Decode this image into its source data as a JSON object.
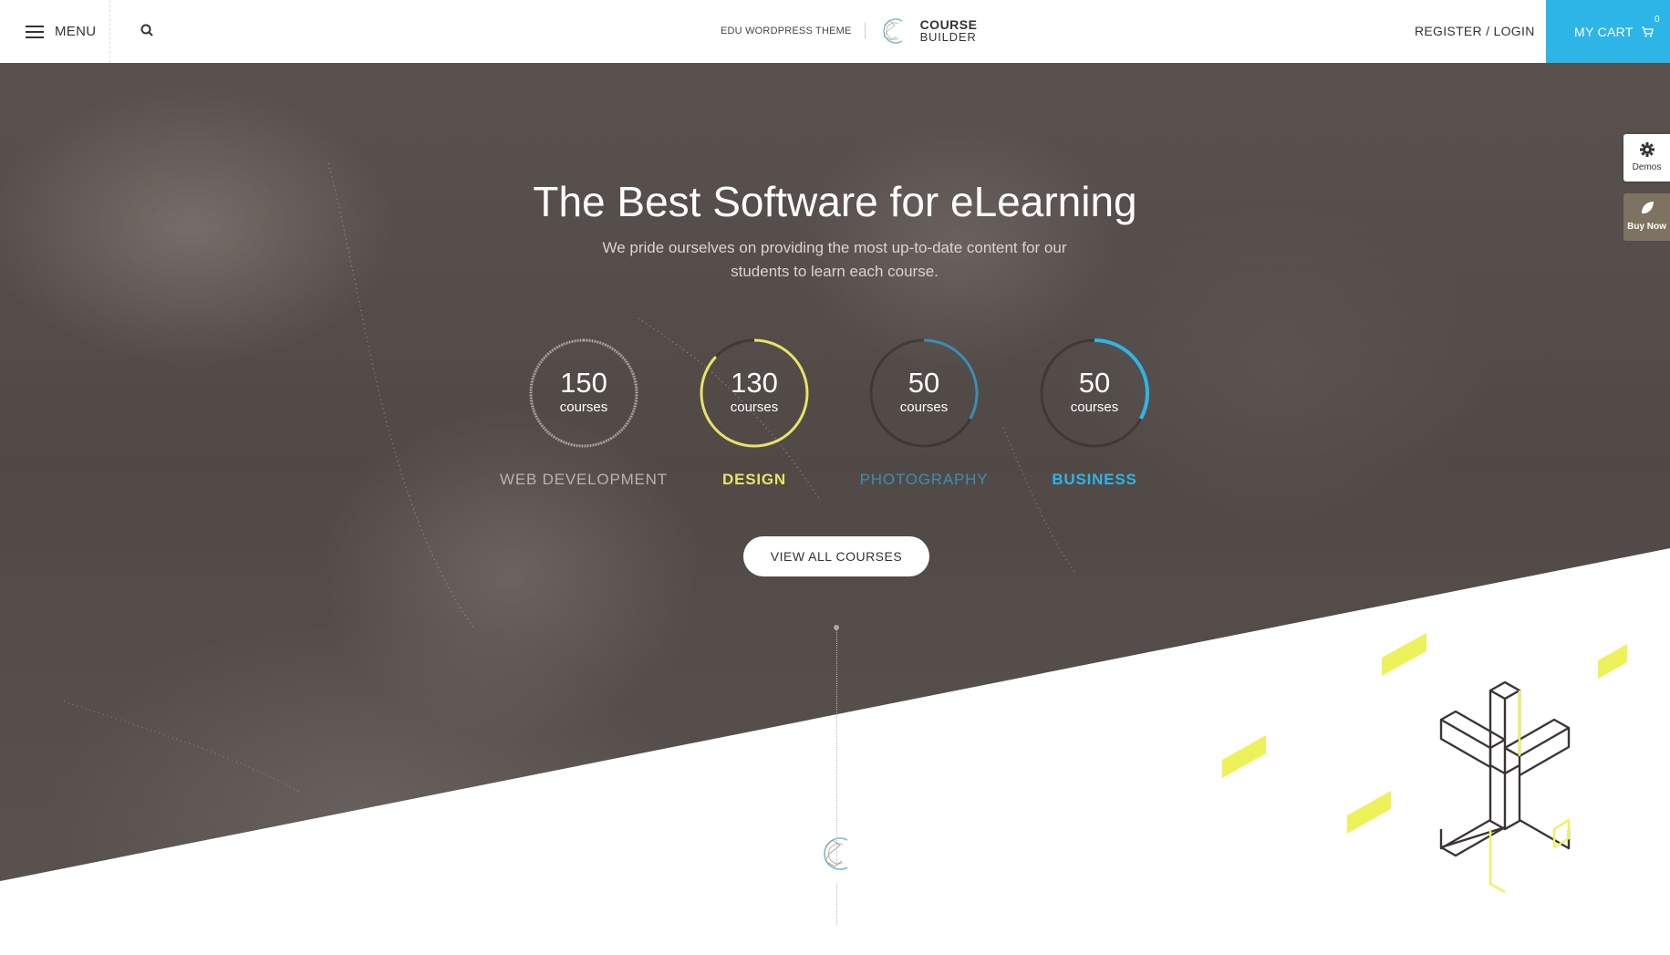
{
  "header": {
    "menu_label": "MENU",
    "brand_tag": "EDU WORDPRESS THEME",
    "logo_line1": "COURSE",
    "logo_line2": "BUILDER",
    "register_login": "REGISTER / LOGIN",
    "cart_label": "MY CART",
    "cart_count": "0"
  },
  "hero": {
    "title": "The Best Software for eLearning",
    "subtitle": "We pride ourselves on providing the most up-to-date content for our students to learn each course.",
    "cta": "VIEW ALL COURSES"
  },
  "stats": [
    {
      "number": "150",
      "unit": "courses",
      "label": "WEB DEVELOPMENT",
      "color": "#b9b2b0",
      "progress": 1.0
    },
    {
      "number": "130",
      "unit": "courses",
      "label": "DESIGN",
      "color": "#e8e36a",
      "progress": 0.87
    },
    {
      "number": "50",
      "unit": "courses",
      "label": "PHOTOGRAPHY",
      "color": "#3a8fb5",
      "progress": 0.33
    },
    {
      "number": "50",
      "unit": "courses",
      "label": "BUSINESS",
      "color": "#2db5e8",
      "progress": 0.33
    }
  ],
  "side": {
    "demos": "Demos",
    "buy_now": "Buy Now"
  },
  "colors": {
    "accent": "#2db5e8",
    "yellow": "#e8ef5a"
  }
}
